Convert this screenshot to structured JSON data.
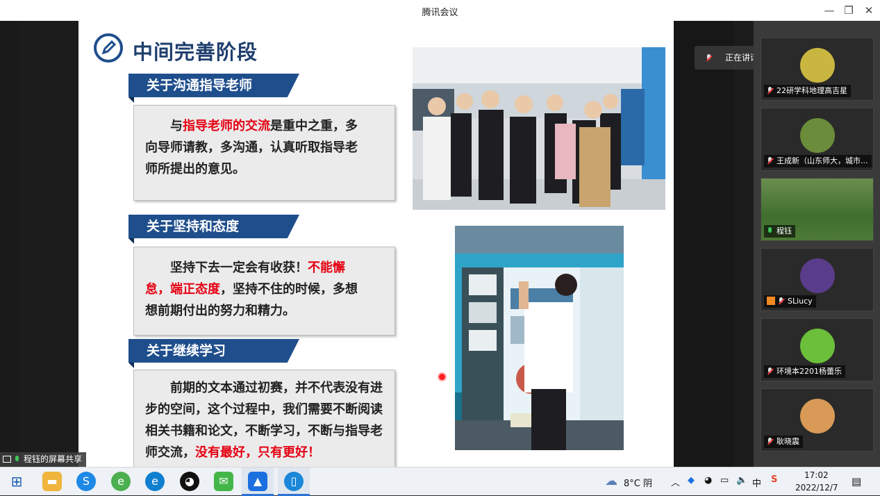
{
  "window": {
    "title": "腾讯会议"
  },
  "slide": {
    "title": "中间完善阶段",
    "sections": [
      {
        "heading": "关于沟通指导老师",
        "lines": [
          [
            {
              "t": "　　与",
              "red": false
            },
            {
              "t": "指导老师的交流",
              "red": true
            },
            {
              "t": "是重中之重，多",
              "red": false
            }
          ],
          [
            {
              "t": "向导师请教，多沟通，认真听取指导老",
              "red": false
            }
          ],
          [
            {
              "t": "师所提出的意见。",
              "red": false
            }
          ]
        ]
      },
      {
        "heading": "关于坚持和态度",
        "lines": [
          [
            {
              "t": "　　坚持下去一定会有收获！",
              "red": false
            },
            {
              "t": "不能懈",
              "red": true
            }
          ],
          [
            {
              "t": "怠，端正态度",
              "red": true
            },
            {
              "t": "，坚持不住的时候，多想",
              "red": false
            }
          ],
          [
            {
              "t": "想前期付出的努力和精力。",
              "red": false
            }
          ]
        ]
      },
      {
        "heading": "关于继续学习",
        "lines": [
          [
            {
              "t": "　　前期的文本通过初赛，并不代表没有进",
              "red": false
            }
          ],
          [
            {
              "t": "步的空间，这个过程中，我们需要不断阅读",
              "red": false
            }
          ],
          [
            {
              "t": "相关书籍和论文，不断学习，不断与指导老",
              "red": false
            }
          ],
          [
            {
              "t": "师交流，",
              "red": false
            },
            {
              "t": "没有最好，只有更好！",
              "red": true
            }
          ]
        ]
      }
    ]
  },
  "speaking": {
    "text": "正在讲话: 程钰"
  },
  "screen_share_label": "程钰的屏幕共享",
  "participants": [
    {
      "name": "22研学科地理高吉星",
      "mic": "muted",
      "color": "#c9b640"
    },
    {
      "name": "王成新（山东师大，城市...",
      "mic": "muted",
      "color": "#6b8c3a"
    },
    {
      "name": "程钰",
      "mic": "on",
      "color": "#4a7a3a"
    },
    {
      "name": "SLiucy",
      "mic": "muted",
      "color": "#5a3d8a"
    },
    {
      "name": "环境本2201杨蕾乐",
      "mic": "muted",
      "color": "#6bbf3a"
    },
    {
      "name": "耿晓震",
      "mic": "muted",
      "color": "#d89a56"
    }
  ],
  "taskbar": {
    "weather": "8°C 阴",
    "time": "17:02",
    "date": "2022/12/7",
    "ime": "中"
  },
  "colors": {
    "accent_blue": "#1f4e8c",
    "highlight_red": "#e60012"
  }
}
